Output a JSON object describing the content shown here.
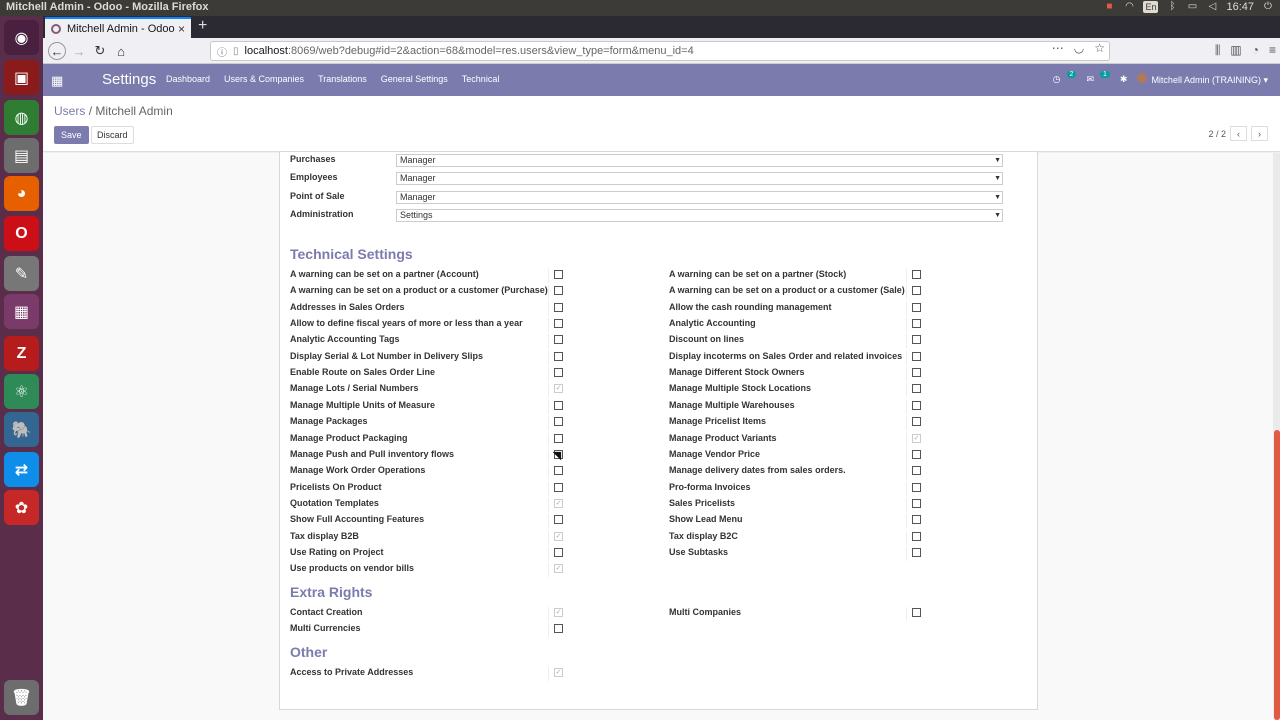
{
  "os": {
    "window_title": "Mitchell Admin - Odoo - Mozilla Firefox",
    "lang": "En",
    "time": "16:47"
  },
  "browser": {
    "tab_title": "Mitchell Admin - Odoo",
    "url_host": "localhost",
    "url_rest": ":8069/web?debug#id=2&action=68&model=res.users&view_type=form&menu_id=4"
  },
  "odoo_nav": {
    "brand": "Settings",
    "menu": [
      "Dashboard",
      "Users & Companies",
      "Translations",
      "General Settings",
      "Technical"
    ],
    "activity_badge": "2",
    "message_badge": "1",
    "user": "Mitchell Admin (TRAINING)"
  },
  "control_panel": {
    "breadcrumb_parent": "Users",
    "breadcrumb_sep": "/",
    "breadcrumb_current": "Mitchell Admin",
    "save_label": "Save",
    "discard_label": "Discard",
    "pager": "2 / 2"
  },
  "selects": [
    {
      "label": "Purchases",
      "value": "Manager"
    },
    {
      "label": "Employees",
      "value": "Manager"
    },
    {
      "label": "Point of Sale",
      "value": "Manager"
    },
    {
      "label": "Administration",
      "value": "Settings"
    }
  ],
  "sections": {
    "technical": "Technical Settings",
    "extra": "Extra Rights",
    "other": "Other"
  },
  "technical_left": [
    {
      "label": "A warning can be set on a partner (Account)",
      "checked": false
    },
    {
      "label": "A warning can be set on a product or a customer (Purchase)",
      "checked": false
    },
    {
      "label": "Addresses in Sales Orders",
      "checked": false
    },
    {
      "label": "Allow to define fiscal years of more or less than a year",
      "checked": false
    },
    {
      "label": "Analytic Accounting Tags",
      "checked": false
    },
    {
      "label": "Display Serial & Lot Number in Delivery Slips",
      "checked": false
    },
    {
      "label": "Enable Route on Sales Order Line",
      "checked": false
    },
    {
      "label": "Manage Lots / Serial Numbers",
      "checked": true
    },
    {
      "label": "Manage Multiple Units of Measure",
      "checked": false
    },
    {
      "label": "Manage Packages",
      "checked": false
    },
    {
      "label": "Manage Product Packaging",
      "checked": false
    },
    {
      "label": "Manage Push and Pull inventory flows",
      "checked": false
    },
    {
      "label": "Manage Work Order Operations",
      "checked": false
    },
    {
      "label": "Pricelists On Product",
      "checked": false
    },
    {
      "label": "Quotation Templates",
      "checked": true
    },
    {
      "label": "Show Full Accounting Features",
      "checked": false
    },
    {
      "label": "Tax display B2B",
      "checked": true
    },
    {
      "label": "Use Rating on Project",
      "checked": false
    },
    {
      "label": "Use products on vendor bills",
      "checked": true
    }
  ],
  "technical_right": [
    {
      "label": "A warning can be set on a partner (Stock)",
      "checked": false
    },
    {
      "label": "A warning can be set on a product or a customer (Sale)",
      "checked": false
    },
    {
      "label": "Allow the cash rounding management",
      "checked": false
    },
    {
      "label": "Analytic Accounting",
      "checked": false
    },
    {
      "label": "Discount on lines",
      "checked": false
    },
    {
      "label": "Display incoterms on Sales Order and related invoices",
      "checked": false
    },
    {
      "label": "Manage Different Stock Owners",
      "checked": false
    },
    {
      "label": "Manage Multiple Stock Locations",
      "checked": false
    },
    {
      "label": "Manage Multiple Warehouses",
      "checked": false
    },
    {
      "label": "Manage Pricelist Items",
      "checked": false
    },
    {
      "label": "Manage Product Variants",
      "checked": true
    },
    {
      "label": "Manage Vendor Price",
      "checked": false
    },
    {
      "label": "Manage delivery dates from sales orders.",
      "checked": false
    },
    {
      "label": "Pro-forma Invoices",
      "checked": false
    },
    {
      "label": "Sales Pricelists",
      "checked": false
    },
    {
      "label": "Show Lead Menu",
      "checked": false
    },
    {
      "label": "Tax display B2C",
      "checked": false
    },
    {
      "label": "Use Subtasks",
      "checked": false
    }
  ],
  "extra_left": [
    {
      "label": "Contact Creation",
      "checked": true
    },
    {
      "label": "Multi Currencies",
      "checked": false
    }
  ],
  "extra_right": [
    {
      "label": "Multi Companies",
      "checked": false
    }
  ],
  "other_left": [
    {
      "label": "Access to Private Addresses",
      "checked": true
    }
  ]
}
